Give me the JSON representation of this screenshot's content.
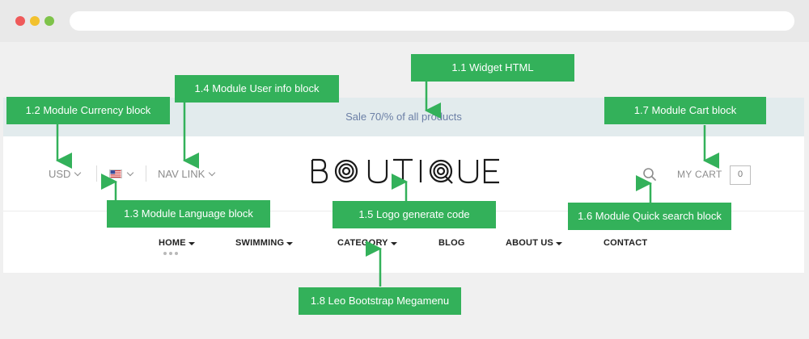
{
  "banner": {
    "text": "Sale 70/% of all products"
  },
  "header": {
    "currency": "USD",
    "nav_link": "NAV LINK",
    "logo": "BOUTIQUE",
    "cart_label": "MY CART",
    "cart_count": "0"
  },
  "menu": {
    "items": [
      {
        "label": "HOME"
      },
      {
        "label": "SWIMMING"
      },
      {
        "label": "CATEGORY"
      },
      {
        "label": "BLOG"
      },
      {
        "label": "ABOUT US"
      },
      {
        "label": "CONTACT"
      }
    ]
  },
  "callouts": {
    "widget": "1.1 Widget HTML",
    "currency": "1.2 Module Currency block",
    "language": "1.3 Module Language block",
    "userinfo": "1.4 Module User info block",
    "logo": "1.5 Logo generate code",
    "search": "1.6 Module Quick search block",
    "cart": "1.7 Module Cart block",
    "megamenu": "1.8 Leo Bootstrap Megamenu"
  },
  "colors": {
    "callout": "#33b15a",
    "banner": "#e2ebed",
    "banner_text": "#6b7fa6"
  }
}
